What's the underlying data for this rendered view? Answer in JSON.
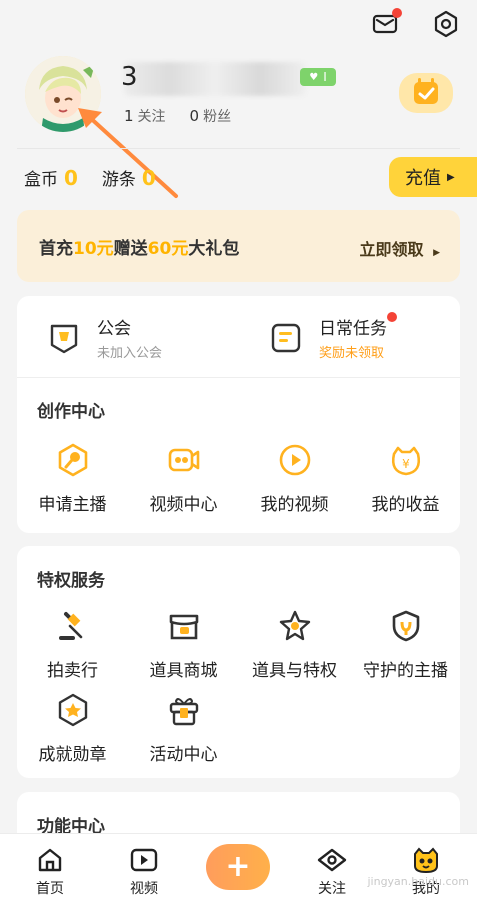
{
  "header": {
    "mail_icon": "mail-icon",
    "settings_icon": "gear-icon",
    "mail_badge_color": "#f44336"
  },
  "profile": {
    "name_visible_prefix": "3",
    "level_badge": "I",
    "follow_count": "1",
    "follow_label": "关注",
    "fans_count": "0",
    "fans_label": "粉丝"
  },
  "wallet": {
    "box_coin_label": "盒币",
    "box_coin_value": "0",
    "stripe_label": "游条",
    "stripe_value": "0",
    "recharge_label": "充值"
  },
  "promo": {
    "prefix": "首充",
    "amount1": "10元",
    "middle": "赠送",
    "amount2": "60元",
    "suffix": "大礼包",
    "cta": "立即领取"
  },
  "guild": {
    "title": "公会",
    "subtitle": "未加入公会"
  },
  "task": {
    "title": "日常任务",
    "subtitle": "奖励未领取"
  },
  "creation": {
    "title": "创作中心",
    "items": [
      {
        "label": "申请主播",
        "icon": "microphone-icon"
      },
      {
        "label": "视频中心",
        "icon": "video-camera-icon"
      },
      {
        "label": "我的视频",
        "icon": "play-icon"
      },
      {
        "label": "我的收益",
        "icon": "money-bag-icon"
      }
    ]
  },
  "privilege": {
    "title": "特权服务",
    "items": [
      {
        "label": "拍卖行",
        "icon": "auction-hammer-icon"
      },
      {
        "label": "道具商城",
        "icon": "shop-icon"
      },
      {
        "label": "道具与特权",
        "icon": "star-icon"
      },
      {
        "label": "守护的主播",
        "icon": "shield-icon"
      },
      {
        "label": "成就勋章",
        "icon": "medal-icon"
      },
      {
        "label": "活动中心",
        "icon": "gift-icon"
      }
    ]
  },
  "function": {
    "title": "功能中心"
  },
  "nav": {
    "items": [
      {
        "label": "首页",
        "icon": "home-icon"
      },
      {
        "label": "视频",
        "icon": "video-icon"
      },
      {
        "label": "",
        "icon": "plus-icon"
      },
      {
        "label": "关注",
        "icon": "eye-icon"
      },
      {
        "label": "我的",
        "icon": "avatar-face-icon"
      }
    ]
  },
  "watermark": "jingyan.baidu.com",
  "colors": {
    "accent": "#ffc21a",
    "promo_bg": "#fbefd9",
    "level_badge": "#7ed36b",
    "dot": "#f44336"
  }
}
